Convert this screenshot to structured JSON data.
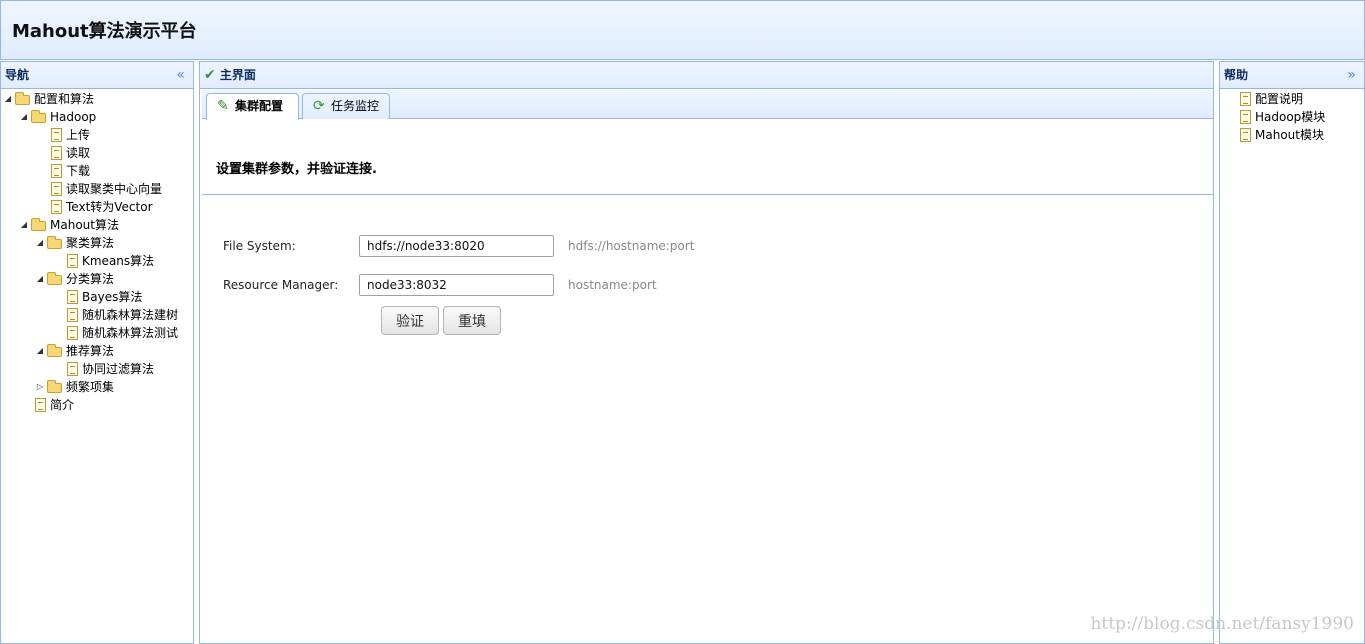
{
  "header": {
    "title": "Mahout算法演示平台"
  },
  "west": {
    "title": "导航",
    "tree": [
      {
        "label": "配置和算法",
        "type": "folder",
        "level": 0,
        "state": "open"
      },
      {
        "label": "Hadoop",
        "type": "folder",
        "level": 1,
        "state": "open"
      },
      {
        "label": "上传",
        "type": "file",
        "level": 2
      },
      {
        "label": "读取",
        "type": "file",
        "level": 2
      },
      {
        "label": "下载",
        "type": "file",
        "level": 2
      },
      {
        "label": "读取聚类中心向量",
        "type": "file",
        "level": 2
      },
      {
        "label": "Text转为Vector",
        "type": "file",
        "level": 2
      },
      {
        "label": "Mahout算法",
        "type": "folder",
        "level": 1,
        "state": "open"
      },
      {
        "label": "聚类算法",
        "type": "folder",
        "level": 2,
        "state": "open"
      },
      {
        "label": "Kmeans算法",
        "type": "file",
        "level": 3
      },
      {
        "label": "分类算法",
        "type": "folder",
        "level": 2,
        "state": "open"
      },
      {
        "label": "Bayes算法",
        "type": "file",
        "level": 3
      },
      {
        "label": "随机森林算法建树",
        "type": "file",
        "level": 3
      },
      {
        "label": "随机森林算法测试",
        "type": "file",
        "level": 3
      },
      {
        "label": "推荐算法",
        "type": "folder",
        "level": 2,
        "state": "open"
      },
      {
        "label": "协同过滤算法",
        "type": "file",
        "level": 3
      },
      {
        "label": "频繁项集",
        "type": "folder",
        "level": 2,
        "state": "closed"
      },
      {
        "label": "简介",
        "type": "file",
        "level": 1
      }
    ]
  },
  "center": {
    "title": "主界面",
    "tabs": [
      {
        "label": "集群配置",
        "icon": "pencil-icon",
        "active": true
      },
      {
        "label": "任务监控",
        "icon": "refresh-icon",
        "active": false
      }
    ],
    "description": "设置集群参数，并验证连接.",
    "form": {
      "file_system": {
        "label": "File System:",
        "value": "hdfs://node33:8020",
        "hint": "hdfs://hostname:port"
      },
      "resource_manager": {
        "label": "Resource Manager:",
        "value": "node33:8032",
        "hint": "hostname:port"
      },
      "verify_label": "验证",
      "reset_label": "重填"
    }
  },
  "east": {
    "title": "帮助",
    "items": [
      {
        "label": "配置说明"
      },
      {
        "label": "Hadoop模块"
      },
      {
        "label": "Mahout模块"
      }
    ]
  },
  "watermark": "http://blog.csdn.net/fansy1990",
  "colors": {
    "border": "#95b8e7",
    "header_bg": "#e0ecff",
    "title_text": "#0e2d5f"
  }
}
